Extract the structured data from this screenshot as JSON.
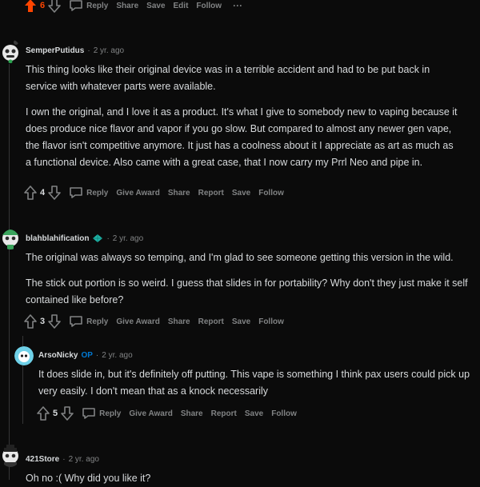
{
  "top_actions": {
    "count": "6",
    "reply": "Reply",
    "share": "Share",
    "save": "Save",
    "edit": "Edit",
    "follow": "Follow",
    "more": "···"
  },
  "comments": [
    {
      "username": "SemperPutidus",
      "dot": "·",
      "time": "2 yr. ago",
      "paragraphs": [
        "This thing looks like their original device was in a terrible accident and had to be put back in service with whatever parts were available.",
        "I own the original, and I love it as a product. It's what I give to somebody new to vaping because it does produce nice flavor and vapor if you go slow. But compared to almost any newer gen vape, the flavor isn't competitive anymore. It just has a coolness about it I appreciate as art as much as a functional device. Also came with a great case, that I now carry my Prrl Neo and pipe in."
      ],
      "votes": "4",
      "actions": [
        "Reply",
        "Give Award",
        "Share",
        "Report",
        "Save",
        "Follow"
      ]
    },
    {
      "username": "blahblahification",
      "dot": "·",
      "time": "2 yr. ago",
      "paragraphs": [
        "The original was always so temping, and I'm glad to see someone getting this version in the wild.",
        "The stick out portion is so weird. I guess that slides in for portability? Why don't they just make it self contained like before?"
      ],
      "votes": "3",
      "actions": [
        "Reply",
        "Give Award",
        "Share",
        "Report",
        "Save",
        "Follow"
      ]
    },
    {
      "username": "ArsoNicky",
      "badge": "OP",
      "dot": "·",
      "time": "2 yr. ago",
      "paragraphs": [
        "It does slide in, but it's definitely off putting. This vape is something I think pax users could pick up very easily. I don't mean that as a knock necessarily"
      ],
      "votes": "5",
      "actions": [
        "Reply",
        "Give Award",
        "Share",
        "Report",
        "Save",
        "Follow"
      ]
    },
    {
      "username": "421Store",
      "dot": "·",
      "time": "2 yr. ago",
      "paragraphs": [
        "Oh no :( Why did you like it?"
      ]
    }
  ],
  "colors": {
    "background": "#0b0b0b",
    "text": "#d7dadc",
    "muted": "#818384",
    "upvote": "#ff4500",
    "op_badge": "#0079d3"
  }
}
